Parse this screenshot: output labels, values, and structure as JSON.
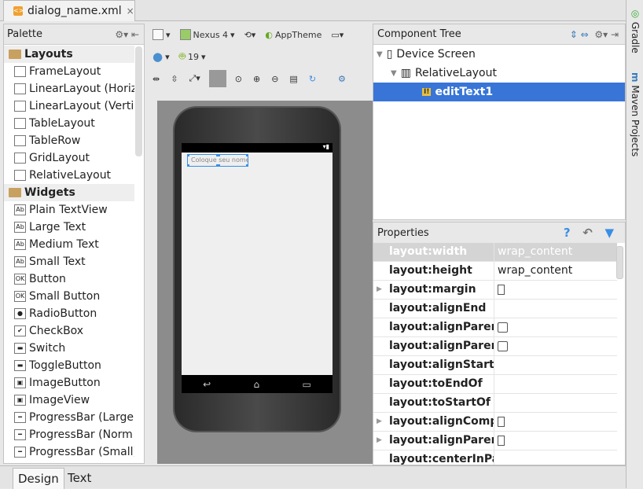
{
  "editor_tab": {
    "filename": "dialog_name.xml",
    "close": "×"
  },
  "palette": {
    "title": "Palette",
    "items": [
      {
        "label": "Layouts",
        "category": true
      },
      {
        "label": "FrameLayout"
      },
      {
        "label": "LinearLayout (Horiz"
      },
      {
        "label": "LinearLayout (Vertic"
      },
      {
        "label": "TableLayout"
      },
      {
        "label": "TableRow"
      },
      {
        "label": "GridLayout"
      },
      {
        "label": "RelativeLayout"
      },
      {
        "label": "Widgets",
        "category": true
      },
      {
        "label": "Plain TextView",
        "icon": "Ab"
      },
      {
        "label": "Large Text",
        "icon": "Ab"
      },
      {
        "label": "Medium Text",
        "icon": "Ab"
      },
      {
        "label": "Small Text",
        "icon": "Ab"
      },
      {
        "label": "Button",
        "icon": "OK"
      },
      {
        "label": "Small Button",
        "icon": "OK"
      },
      {
        "label": "RadioButton",
        "icon": "●"
      },
      {
        "label": "CheckBox",
        "icon": "✔"
      },
      {
        "label": "Switch",
        "icon": "▬"
      },
      {
        "label": "ToggleButton",
        "icon": "▬"
      },
      {
        "label": "ImageButton",
        "icon": "▣"
      },
      {
        "label": "ImageView",
        "icon": "▣"
      },
      {
        "label": "ProgressBar (Large",
        "icon": "━"
      },
      {
        "label": "ProgressBar (Norm",
        "icon": "━"
      },
      {
        "label": "ProgressBar (Small)",
        "icon": "━"
      }
    ]
  },
  "toolbar": {
    "device": "Nexus 4",
    "theme": "AppTheme",
    "api": "19"
  },
  "preview": {
    "edittext_hint": "Coloque seu nome"
  },
  "component_tree": {
    "title": "Component Tree",
    "nodes": [
      {
        "label": "Device Screen"
      },
      {
        "label": "RelativeLayout"
      },
      {
        "label": "editText1"
      }
    ]
  },
  "properties": {
    "title": "Properties",
    "rows": [
      {
        "key": "layout:width",
        "value": "wrap_content"
      },
      {
        "key": "layout:height",
        "value": "wrap_content"
      },
      {
        "key": "layout:margin",
        "value": "[]",
        "expand": true
      },
      {
        "key": "layout:alignEnd",
        "value": ""
      },
      {
        "key": "layout:alignParent",
        "value": "checkbox"
      },
      {
        "key": "layout:alignParent",
        "value": "checkbox"
      },
      {
        "key": "layout:alignStart",
        "value": ""
      },
      {
        "key": "layout:toEndOf",
        "value": ""
      },
      {
        "key": "layout:toStartOf",
        "value": ""
      },
      {
        "key": "layout:alignCompo",
        "value": "[]",
        "expand": true
      },
      {
        "key": "layout:alignParent",
        "value": "[]",
        "expand": true
      },
      {
        "key": "layout:centerInPar",
        "value": ""
      }
    ]
  },
  "bottom_tabs": {
    "design": "Design",
    "text": "Text"
  },
  "right_sidebar": {
    "gradle": "Gradle",
    "maven": "Maven Projects"
  },
  "colors": {
    "selection": "#3875d7",
    "accent": "#3a8ee6"
  }
}
